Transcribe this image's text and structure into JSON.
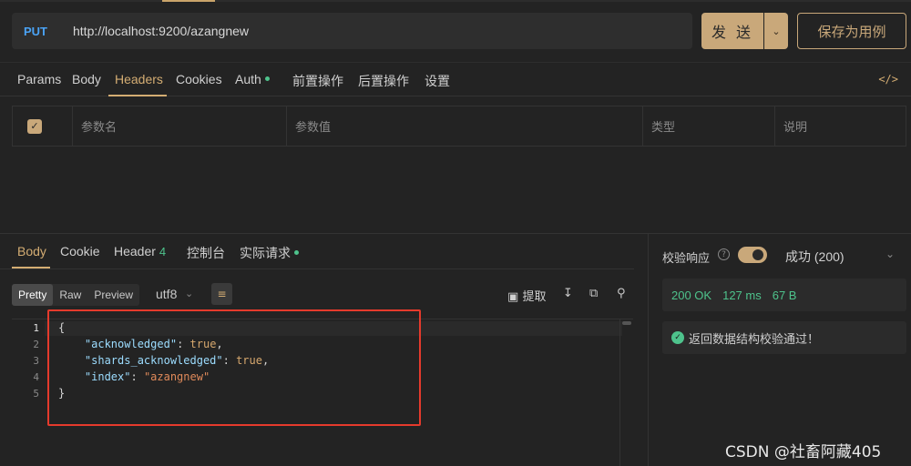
{
  "request": {
    "method": "PUT",
    "url": "http://localhost:9200/azangnew",
    "send_label": "发 送",
    "save_label": "保存为用例"
  },
  "request_tabs": [
    {
      "label": "Params"
    },
    {
      "label": "Body"
    },
    {
      "label": "Headers",
      "active": true
    },
    {
      "label": "Cookies"
    },
    {
      "label": "Auth"
    },
    {
      "label": "前置操作"
    },
    {
      "label": "后置操作"
    },
    {
      "label": "设置"
    }
  ],
  "params_table": {
    "columns": [
      "参数名",
      "参数值",
      "类型",
      "说明"
    ]
  },
  "response_tabs": [
    {
      "label": "Body",
      "active": true
    },
    {
      "label": "Cookie"
    },
    {
      "label": "Header",
      "badge": "4"
    },
    {
      "label": "控制台"
    },
    {
      "label": "实际请求"
    }
  ],
  "response_toolbar": {
    "views": [
      "Pretty",
      "Raw",
      "Preview"
    ],
    "selected_view": "Pretty",
    "encoding": "utf8",
    "extract_label": "提取"
  },
  "response_body": {
    "line_numbers": [
      "1",
      "2",
      "3",
      "4",
      "5"
    ],
    "lines": [
      "{",
      "    \"acknowledged\": true,",
      "    \"shards_acknowledged\": true,",
      "    \"index\": \"azangnew\"",
      "}"
    ]
  },
  "validation": {
    "title": "校验响应",
    "result": "成功 (200)",
    "status": "200 OK",
    "time": "127 ms",
    "size": "67 B",
    "message": "返回数据结构校验通过！"
  },
  "watermark": "CSDN @社畜阿藏405",
  "colors": {
    "accent": "#c9a87a",
    "method": "#4aa3f5",
    "success": "#4ec38c",
    "highlight_box": "#e53a2c"
  }
}
